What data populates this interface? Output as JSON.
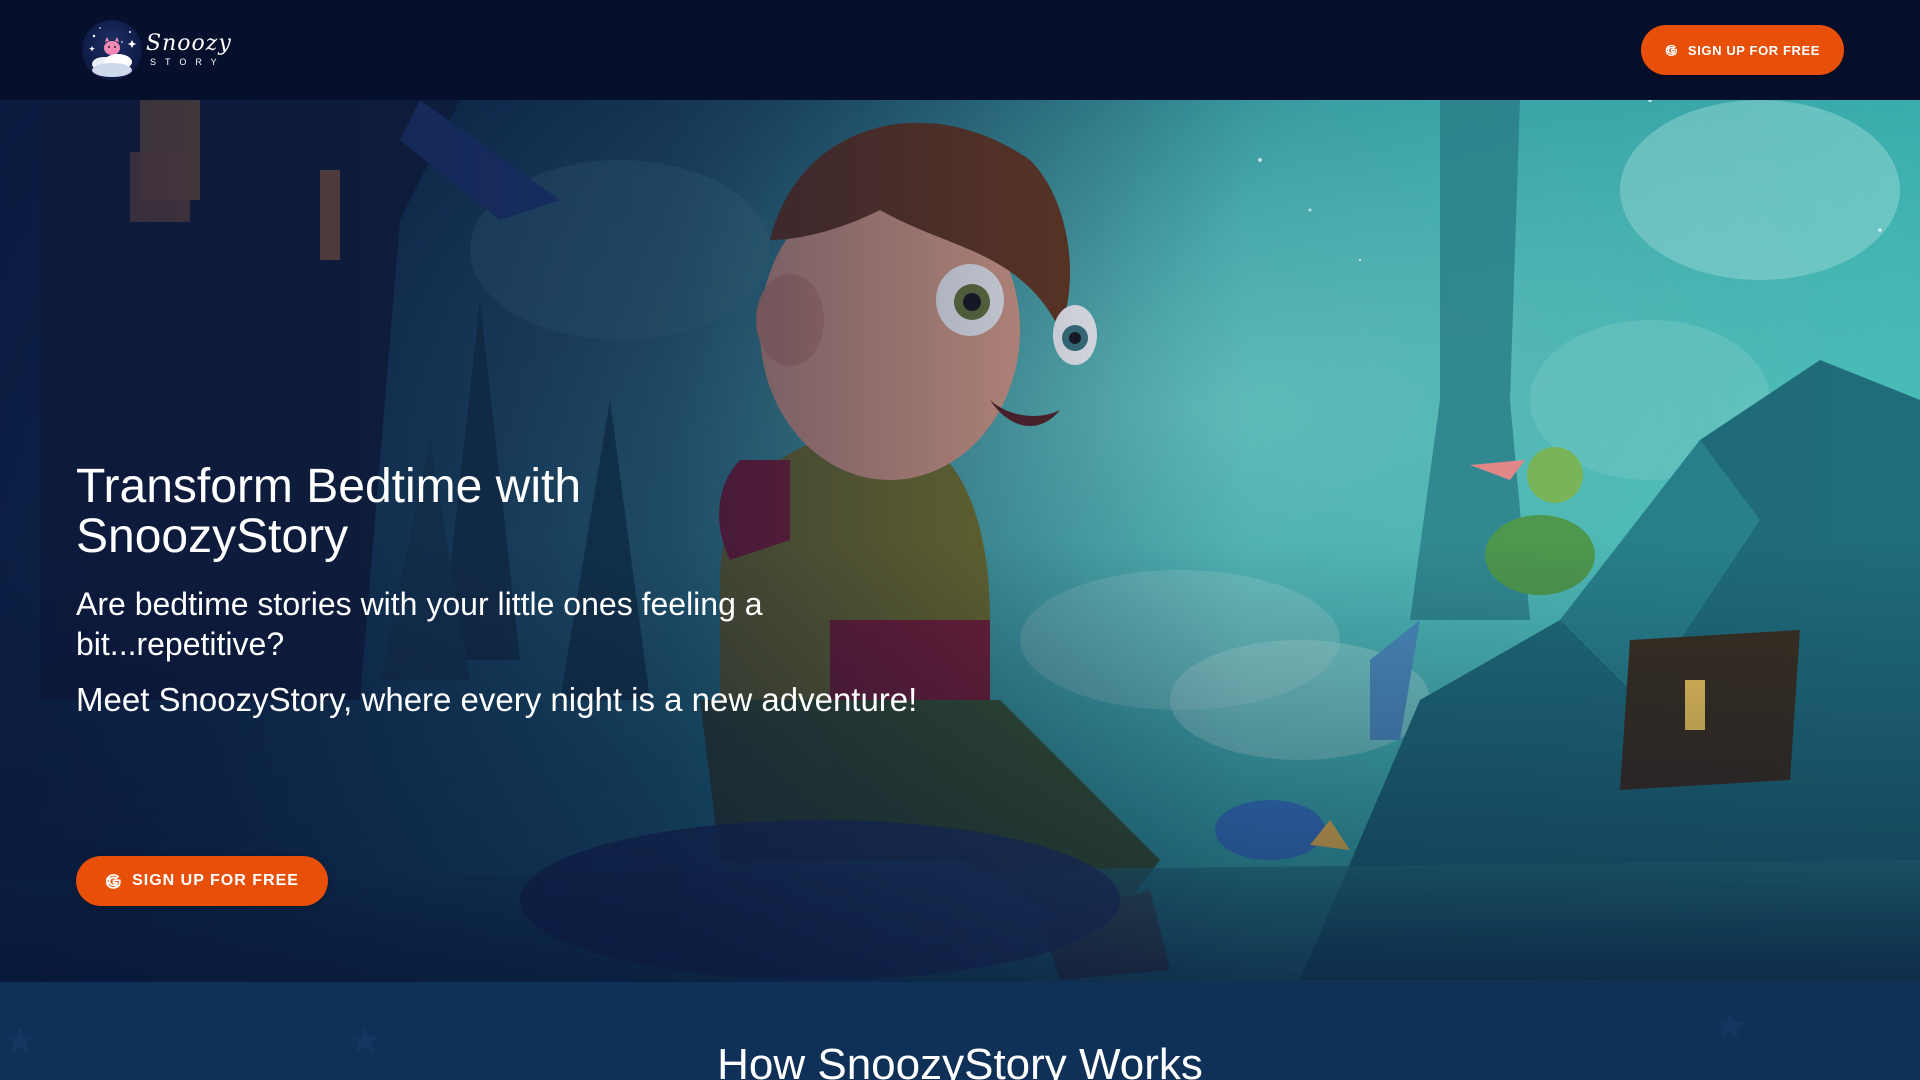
{
  "brand": {
    "name": "SnoozyStory",
    "logo_main": "Snoozy",
    "logo_sub": "STORY"
  },
  "navbar": {
    "signup_label": "SIGN UP FOR FREE",
    "signup_icon": "google-g-icon"
  },
  "hero": {
    "title": "Transform Bedtime with SnoozyStory",
    "subtitle": "Are bedtime stories with your little ones feeling a bit...repetitive?",
    "tagline": "Meet SnoozyStory, where every night is a new adventure!",
    "cta_label": "SIGN UP FOR FREE",
    "cta_icon": "google-g-icon"
  },
  "how_it_works": {
    "title": "How SnoozyStory Works"
  },
  "colors": {
    "navbar_bg": "#060f2c",
    "cta": "#e8500a",
    "section_bg": "#0f3057",
    "text": "#ffffff"
  }
}
